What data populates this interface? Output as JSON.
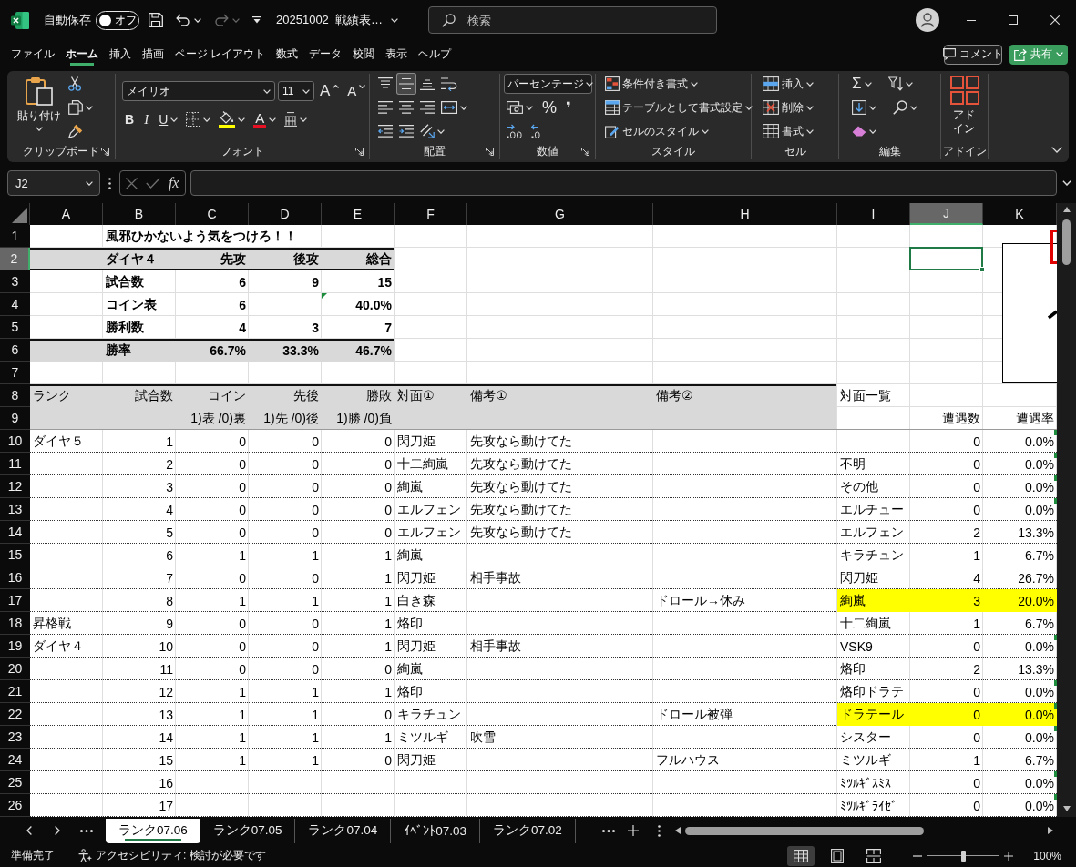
{
  "title_bar": {
    "autosave_label": "自動保存",
    "autosave_toggle": {
      "label": "オフ",
      "on": false
    },
    "quick_access": [
      {
        "kind": "save"
      },
      {
        "kind": "undo",
        "disabled": false,
        "caret": true
      },
      {
        "kind": "redo",
        "disabled": true,
        "caret": true
      },
      {
        "kind": "customize"
      }
    ],
    "file_name": "20251002_戦績表…",
    "search": {
      "placeholder": "検索"
    }
  },
  "menu_tabs": [
    {
      "label": "ファイル",
      "selected": false
    },
    {
      "label": "ホーム",
      "selected": true
    },
    {
      "label": "挿入",
      "selected": false
    },
    {
      "label": "描画",
      "selected": false
    },
    {
      "label": "ページ レイアウト",
      "selected": false
    },
    {
      "label": "数式",
      "selected": false
    },
    {
      "label": "データ",
      "selected": false
    },
    {
      "label": "校閲",
      "selected": false
    },
    {
      "label": "表示",
      "selected": false
    },
    {
      "label": "ヘルプ",
      "selected": false
    }
  ],
  "header_buttons": [
    {
      "kind": "comment",
      "label": "コメント"
    },
    {
      "kind": "share",
      "label": "共有",
      "caret": true
    }
  ],
  "ribbon": {
    "groups": [
      {
        "kind": "clipboard",
        "label": "クリップボード",
        "launcher": true,
        "big": {
          "kind": "paste",
          "label": "貼り付け",
          "caret": true
        },
        "rows": [
          {
            "items": [
              {
                "kind": "cut"
              }
            ]
          },
          {
            "items": [
              {
                "kind": "copy",
                "caret": true
              }
            ]
          },
          {
            "items": [
              {
                "kind": "format-painter"
              }
            ]
          }
        ]
      },
      {
        "kind": "font",
        "label": "フォント",
        "launcher": true,
        "rows": [
          {
            "items": [
              {
                "kind": "font-name",
                "value": "メイリオ"
              },
              {
                "kind": "font-size",
                "value": "11"
              },
              {
                "kind": "grow-font",
                "glyph": "A"
              },
              {
                "kind": "shrink-font",
                "glyph": "A"
              }
            ]
          },
          {
            "items": [
              {
                "kind": "bold",
                "glyph": "B"
              },
              {
                "kind": "italic",
                "glyph": "I"
              },
              {
                "kind": "underline",
                "glyph": "U",
                "caret": true
              },
              {
                "kind": "borders",
                "caret": true
              },
              {
                "kind": "fill-color",
                "caret": true
              },
              {
                "kind": "font-color",
                "glyph": "A",
                "caret": true
              },
              {
                "kind": "phonetic",
                "caret": true
              }
            ]
          }
        ]
      },
      {
        "kind": "alignment",
        "label": "配置",
        "launcher": true,
        "rows": [
          {
            "items": [
              {
                "kind": "align-top",
                "selected": false
              },
              {
                "kind": "align-middle",
                "selected": true
              },
              {
                "kind": "align-bottom",
                "selected": false
              },
              {
                "kind": "wrap-text",
                "selected": false
              }
            ]
          },
          {
            "items": [
              {
                "kind": "align-left",
                "selected": false
              },
              {
                "kind": "align-center",
                "selected": false
              },
              {
                "kind": "align-right",
                "selected": false
              },
              {
                "kind": "merge",
                "selected": false,
                "caret": true
              }
            ]
          },
          {
            "items": [
              {
                "kind": "outdent"
              },
              {
                "kind": "indent"
              },
              {
                "kind": "orientation",
                "caret": true
              }
            ]
          }
        ]
      },
      {
        "kind": "number",
        "label": "数値",
        "launcher": true,
        "rows": [
          {
            "items": [
              {
                "kind": "number-format",
                "value": "パーセンテージ"
              }
            ]
          },
          {
            "items": [
              {
                "kind": "accounting",
                "caret": true
              },
              {
                "kind": "percent",
                "glyph": "%"
              },
              {
                "kind": "comma",
                "glyph": "❜"
              }
            ]
          },
          {
            "items": [
              {
                "kind": "increase-decimal"
              },
              {
                "kind": "decrease-decimal"
              }
            ]
          }
        ]
      },
      {
        "kind": "styles",
        "label": "スタイル",
        "launcher": false,
        "rows": [
          {
            "items": [
              {
                "kind": "conditional-format",
                "label": "条件付き書式",
                "caret": true
              }
            ]
          },
          {
            "items": [
              {
                "kind": "format-table",
                "label": "テーブルとして書式設定",
                "caret": true
              }
            ]
          },
          {
            "items": [
              {
                "kind": "cell-styles",
                "label": "セルのスタイル",
                "caret": true
              }
            ]
          }
        ]
      },
      {
        "kind": "cells",
        "label": "セル",
        "launcher": false,
        "rows": [
          {
            "items": [
              {
                "kind": "insert",
                "label": "挿入",
                "caret": true
              }
            ]
          },
          {
            "items": [
              {
                "kind": "delete",
                "label": "削除",
                "caret": true
              }
            ]
          },
          {
            "items": [
              {
                "kind": "format",
                "label": "書式",
                "caret": true
              }
            ]
          }
        ]
      },
      {
        "kind": "editing",
        "label": "編集",
        "launcher": false,
        "rows": [
          {
            "items": [
              {
                "kind": "autosum",
                "glyph": "Σ",
                "caret": true
              },
              {
                "kind": "sort",
                "caret": true
              }
            ]
          },
          {
            "items": [
              {
                "kind": "fill",
                "caret": true
              },
              {
                "kind": "find",
                "caret": true
              }
            ]
          },
          {
            "items": [
              {
                "kind": "clear",
                "caret": true
              }
            ]
          }
        ]
      },
      {
        "kind": "addins",
        "label": "アドイン",
        "launcher": false,
        "big": {
          "kind": "addins",
          "label": "アドイン"
        }
      }
    ]
  },
  "formula_bar": {
    "name_box": "J2",
    "function_label": "fx"
  },
  "sheet": {
    "columns": [
      {
        "label": "A",
        "selected": false
      },
      {
        "label": "B",
        "selected": false
      },
      {
        "label": "C",
        "selected": false
      },
      {
        "label": "D",
        "selected": false
      },
      {
        "label": "E",
        "selected": false
      },
      {
        "label": "F",
        "selected": false
      },
      {
        "label": "G",
        "selected": false
      },
      {
        "label": "H",
        "selected": false
      },
      {
        "label": "I",
        "selected": false
      },
      {
        "label": "J",
        "selected": true
      },
      {
        "label": "K",
        "selected": false
      }
    ],
    "row_numbers": [
      {
        "label": "1",
        "selected": false
      },
      {
        "label": "2",
        "selected": true
      },
      {
        "label": "3",
        "selected": false
      },
      {
        "label": "4",
        "selected": false
      },
      {
        "label": "5",
        "selected": false
      },
      {
        "label": "6",
        "selected": false
      },
      {
        "label": "7",
        "selected": false
      },
      {
        "label": "8",
        "selected": false
      },
      {
        "label": "9",
        "selected": false
      },
      {
        "label": "10",
        "selected": false
      },
      {
        "label": "11",
        "selected": false
      },
      {
        "label": "12",
        "selected": false
      },
      {
        "label": "13",
        "selected": false
      },
      {
        "label": "14",
        "selected": false
      },
      {
        "label": "15",
        "selected": false
      },
      {
        "label": "16",
        "selected": false
      },
      {
        "label": "17",
        "selected": false
      },
      {
        "label": "18",
        "selected": false
      },
      {
        "label": "19",
        "selected": false
      },
      {
        "label": "20",
        "selected": false
      },
      {
        "label": "21",
        "selected": false
      },
      {
        "label": "22",
        "selected": false
      },
      {
        "label": "23",
        "selected": false
      },
      {
        "label": "24",
        "selected": false
      },
      {
        "label": "25",
        "selected": false
      },
      {
        "label": "26",
        "selected": false
      }
    ],
    "summary": {
      "title": "風邪ひかないよう気をつけろ！！",
      "rows": [
        {
          "label": "ダイヤ４",
          "first": "先攻",
          "second": "後攻",
          "total": "総合",
          "shaded": true,
          "total_warning": false
        },
        {
          "label": "試合数",
          "first": "6",
          "second": "9",
          "total": "15",
          "shaded": false,
          "total_warning": false
        },
        {
          "label": "コイン表",
          "first": "6",
          "total": "40.0%",
          "shaded": false,
          "total_warning": true
        },
        {
          "label": "勝利数",
          "first": "4",
          "second": "3",
          "total": "7",
          "shaded": false,
          "total_warning": false
        },
        {
          "label": "勝率",
          "first": "66.7%",
          "second": "33.3%",
          "total": "46.7%",
          "shaded": true,
          "total_warning": false
        }
      ]
    },
    "log": {
      "columns": [
        {
          "label": "ランク"
        },
        {
          "label": "試合数"
        },
        {
          "label": "コイン",
          "note": "1)表 /0)裏"
        },
        {
          "label": "先後",
          "note": "1)先 /0)後"
        },
        {
          "label": "勝敗",
          "note": "1)勝 /0)負"
        },
        {
          "label": "対面①"
        },
        {
          "label": "備考①"
        },
        {
          "label": "備考②"
        }
      ],
      "rows": [
        {
          "rank": "ダイヤ５",
          "game": "1",
          "coin": "0",
          "order": "0",
          "result": "0",
          "opponent": "閃刀姫",
          "note_1": "先攻なら動けてた"
        },
        {
          "game": "2",
          "coin": "0",
          "order": "0",
          "result": "0",
          "opponent": "十二絢嵐",
          "note_1": "先攻なら動けてた"
        },
        {
          "game": "3",
          "coin": "0",
          "order": "0",
          "result": "0",
          "opponent": "絢嵐",
          "note_1": "先攻なら動けてた"
        },
        {
          "game": "4",
          "coin": "0",
          "order": "0",
          "result": "0",
          "opponent": "エルフェン",
          "note_1": "先攻なら動けてた"
        },
        {
          "game": "5",
          "coin": "0",
          "order": "0",
          "result": "0",
          "opponent": "エルフェン",
          "note_1": "先攻なら動けてた"
        },
        {
          "game": "6",
          "coin": "1",
          "order": "1",
          "result": "1",
          "opponent": "絢嵐"
        },
        {
          "game": "7",
          "coin": "0",
          "order": "0",
          "result": "1",
          "opponent": "閃刀姫",
          "note_1": "相手事故"
        },
        {
          "game": "8",
          "coin": "1",
          "order": "1",
          "result": "1",
          "opponent": "白き森",
          "note_2": "ドロール→休み"
        },
        {
          "rank": "昇格戦",
          "game": "9",
          "coin": "0",
          "order": "0",
          "result": "1",
          "opponent": "烙印"
        },
        {
          "rank": "ダイヤ４",
          "game": "10",
          "coin": "0",
          "order": "0",
          "result": "1",
          "opponent": "閃刀姫",
          "note_1": "相手事故"
        },
        {
          "game": "11",
          "coin": "0",
          "order": "0",
          "result": "0",
          "opponent": "絢嵐"
        },
        {
          "game": "12",
          "coin": "1",
          "order": "1",
          "result": "1",
          "opponent": "烙印"
        },
        {
          "game": "13",
          "coin": "1",
          "order": "1",
          "result": "0",
          "opponent": "キラチュン",
          "note_2": "ドロール被弾"
        },
        {
          "game": "14",
          "coin": "1",
          "order": "1",
          "result": "1",
          "opponent": "ミツルギ",
          "note_1": "吹雪"
        },
        {
          "game": "15",
          "coin": "1",
          "order": "1",
          "result": "0",
          "opponent": "閃刀姫",
          "note_2": "フルハウス"
        },
        {
          "game": "16"
        },
        {
          "game": "17"
        }
      ]
    },
    "encounters": {
      "title": "対面一覧",
      "count_header": "遭遇数",
      "rate_header": "遭遇率",
      "rows": [
        {
          "count": "0",
          "rate": "0.0%",
          "highlighted": false,
          "flagged": true
        },
        {
          "name": "不明",
          "count": "0",
          "rate": "0.0%",
          "highlighted": false,
          "flagged": true
        },
        {
          "name": "その他",
          "count": "0",
          "rate": "0.0%",
          "highlighted": false,
          "flagged": true
        },
        {
          "name": "エルチュー",
          "count": "0",
          "rate": "0.0%",
          "highlighted": false,
          "flagged": true
        },
        {
          "name": "エルフェン",
          "count": "2",
          "rate": "13.3%",
          "highlighted": false,
          "flagged": false
        },
        {
          "name": "キラチュン",
          "count": "1",
          "rate": "6.7%",
          "highlighted": false,
          "flagged": false
        },
        {
          "name": "閃刀姫",
          "count": "4",
          "rate": "26.7%",
          "highlighted": false,
          "flagged": false
        },
        {
          "name": "絢嵐",
          "count": "3",
          "rate": "20.0%",
          "highlighted": true,
          "flagged": false
        },
        {
          "name": "十二絢嵐",
          "count": "1",
          "rate": "6.7%",
          "highlighted": false,
          "flagged": false
        },
        {
          "name": "VSK9",
          "count": "0",
          "rate": "0.0%",
          "highlighted": false,
          "flagged": true
        },
        {
          "name": "烙印",
          "count": "2",
          "rate": "13.3%",
          "highlighted": false,
          "flagged": false
        },
        {
          "name": "烙印ドラテ",
          "count": "0",
          "rate": "0.0%",
          "highlighted": false,
          "flagged": true
        },
        {
          "name": "ドラテール",
          "count": "0",
          "rate": "0.0%",
          "highlighted": true,
          "flagged": true
        },
        {
          "name": "シスター",
          "count": "0",
          "rate": "0.0%",
          "highlighted": false,
          "flagged": true
        },
        {
          "name": "ミツルギ",
          "count": "1",
          "rate": "6.7%",
          "highlighted": false,
          "flagged": false
        },
        {
          "name": "ﾐﾂﾙｷﾞｽﾐｽ",
          "count": "0",
          "rate": "0.0%",
          "highlighted": false,
          "flagged": true
        },
        {
          "name": "ﾐﾂﾙｷﾞﾗｲｾﾞ",
          "count": "0",
          "rate": "0.0%",
          "highlighted": false,
          "flagged": true
        }
      ]
    }
  },
  "sheet_tabs": [
    {
      "label": "ランク07.06",
      "selected": true
    },
    {
      "label": "ランク07.05",
      "selected": false
    },
    {
      "label": "ランク07.04",
      "selected": false
    },
    {
      "label": "ｲﾍﾞﾝﾄ07.03",
      "selected": false
    },
    {
      "label": "ランク07.02",
      "selected": false
    }
  ],
  "status_bar": {
    "ready": "準備完了",
    "accessibility": "アクセシビリティ: 検討が必要です",
    "views": [
      {
        "kind": "normal",
        "selected": true
      },
      {
        "kind": "page-layout",
        "selected": false
      },
      {
        "kind": "page-break",
        "selected": false
      }
    ],
    "zoom": {
      "level": 0.5,
      "reading": "100%"
    }
  }
}
